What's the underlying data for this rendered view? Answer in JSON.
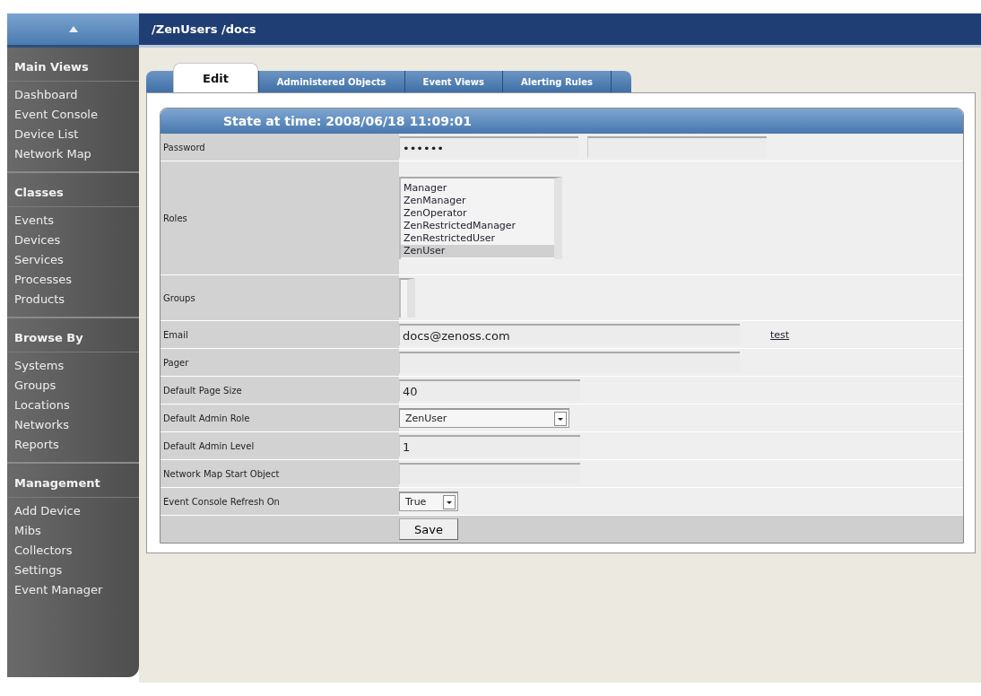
{
  "breadcrumb": "/ZenUsers /docs",
  "sidebar": [
    {
      "title": "Main Views",
      "items": [
        "Dashboard",
        "Event Console",
        "Device List",
        "Network Map"
      ]
    },
    {
      "title": "Classes",
      "items": [
        "Events",
        "Devices",
        "Services",
        "Processes",
        "Products"
      ]
    },
    {
      "title": "Browse By",
      "items": [
        "Systems",
        "Groups",
        "Locations",
        "Networks",
        "Reports"
      ]
    },
    {
      "title": "Management",
      "items": [
        "Add Device",
        "Mibs",
        "Collectors",
        "Settings",
        "Event Manager"
      ]
    }
  ],
  "tabs": [
    {
      "label": "Edit",
      "selected": true
    },
    {
      "label": "Administered Objects",
      "selected": false
    },
    {
      "label": "Event Views",
      "selected": false
    },
    {
      "label": "Alerting Rules",
      "selected": false
    }
  ],
  "form": {
    "header": "State at time: 2008/06/18 11:09:01",
    "rows": [
      {
        "label": "Password",
        "kind": "password",
        "value": "••••••"
      },
      {
        "label": "Roles",
        "kind": "listbox",
        "options": [
          {
            "label": "Manager",
            "selected": false
          },
          {
            "label": "ZenManager",
            "selected": false
          },
          {
            "label": "ZenOperator",
            "selected": false
          },
          {
            "label": "ZenRestrictedManager",
            "selected": false
          },
          {
            "label": "ZenRestrictedUser",
            "selected": false
          },
          {
            "label": "ZenUser",
            "selected": true
          }
        ]
      },
      {
        "label": "Groups",
        "kind": "listbox",
        "options": []
      },
      {
        "label": "Email",
        "kind": "widetext",
        "value": "docs@zenoss.com",
        "link": "test"
      },
      {
        "label": "Pager",
        "kind": "widetext"
      },
      {
        "label": "Default Page Size",
        "kind": "text",
        "value": "40"
      },
      {
        "label": "Default Admin Role",
        "kind": "select",
        "value": "ZenUser"
      },
      {
        "label": "Default Admin Level",
        "kind": "text",
        "value": "1"
      },
      {
        "label": "Network Map Start Object",
        "kind": "text"
      },
      {
        "label": "Event Console Refresh On",
        "kind": "smallselect",
        "value": "True"
      }
    ],
    "submit": "Save"
  }
}
